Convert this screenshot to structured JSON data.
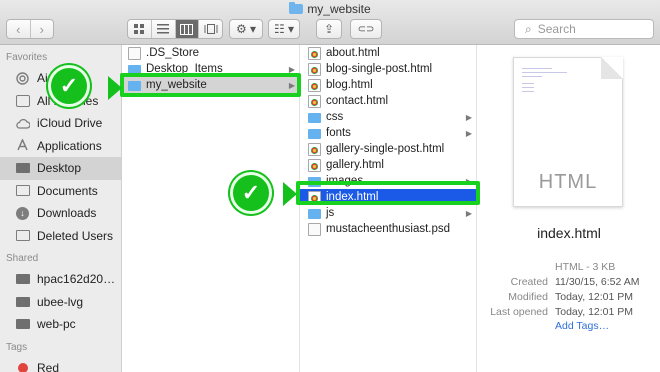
{
  "window": {
    "title": "my_website"
  },
  "toolbar": {
    "back_glyph": "‹",
    "forward_glyph": "›",
    "view_icons": [
      "icon-view-icon",
      "list-view-icon",
      "column-view-icon",
      "coverflow-view-icon"
    ],
    "action_glyph": "⚙ ▾",
    "arrange_glyph": "☷ ▾",
    "share_glyph": "⇪",
    "tag_glyph": "⊂⊃",
    "search_placeholder": "Search"
  },
  "sidebar": {
    "favorites_header": "Favorites",
    "favorites": [
      {
        "label": "AirDrop",
        "icon": "airdrop-icon"
      },
      {
        "label": "All My Files",
        "icon": "all-files-icon"
      },
      {
        "label": "iCloud Drive",
        "icon": "cloud-icon"
      },
      {
        "label": "Applications",
        "icon": "applications-icon"
      },
      {
        "label": "Desktop",
        "icon": "desktop-icon",
        "selected": true
      },
      {
        "label": "Documents",
        "icon": "documents-icon"
      },
      {
        "label": "Downloads",
        "icon": "downloads-icon"
      },
      {
        "label": "Deleted Users",
        "icon": "folder-icon"
      }
    ],
    "shared_header": "Shared",
    "shared": [
      {
        "label": "hpac162d20…",
        "icon": "computer-icon"
      },
      {
        "label": "ubee-lvg",
        "icon": "computer-icon"
      },
      {
        "label": "web-pc",
        "icon": "computer-icon"
      }
    ],
    "tags_header": "Tags",
    "tags": [
      {
        "label": "Red",
        "color": "#e0443c"
      }
    ]
  },
  "column1": {
    "items": [
      {
        "label": ".DS_Store",
        "type": "doc"
      },
      {
        "label": "Desktop_Items",
        "type": "folder",
        "chevron": true
      },
      {
        "label": "my_website",
        "type": "folder",
        "chevron": true,
        "selected": "grey"
      }
    ]
  },
  "column2": {
    "items": [
      {
        "label": "about.html",
        "type": "html"
      },
      {
        "label": "blog-single-post.html",
        "type": "html"
      },
      {
        "label": "blog.html",
        "type": "html"
      },
      {
        "label": "contact.html",
        "type": "html"
      },
      {
        "label": "css",
        "type": "folder",
        "chevron": true
      },
      {
        "label": "fonts",
        "type": "folder",
        "chevron": true
      },
      {
        "label": "gallery-single-post.html",
        "type": "html"
      },
      {
        "label": "gallery.html",
        "type": "html"
      },
      {
        "label": "images",
        "type": "folder",
        "chevron": true
      },
      {
        "label": "index.html",
        "type": "html",
        "selected": "blue"
      },
      {
        "label": "js",
        "type": "folder",
        "chevron": true
      },
      {
        "label": "mustacheenthusiast.psd",
        "type": "doc"
      }
    ]
  },
  "preview": {
    "thumb_label": "HTML",
    "name": "index.html",
    "kind": "HTML - 3 KB",
    "created_label": "Created",
    "created": "11/30/15, 6:52 AM",
    "modified_label": "Modified",
    "modified": "Today, 12:01 PM",
    "last_opened_label": "Last opened",
    "last_opened": "Today, 12:01 PM",
    "add_tags": "Add Tags…"
  },
  "annotations": {
    "checkmark": "✓",
    "color": "#18d01e"
  }
}
